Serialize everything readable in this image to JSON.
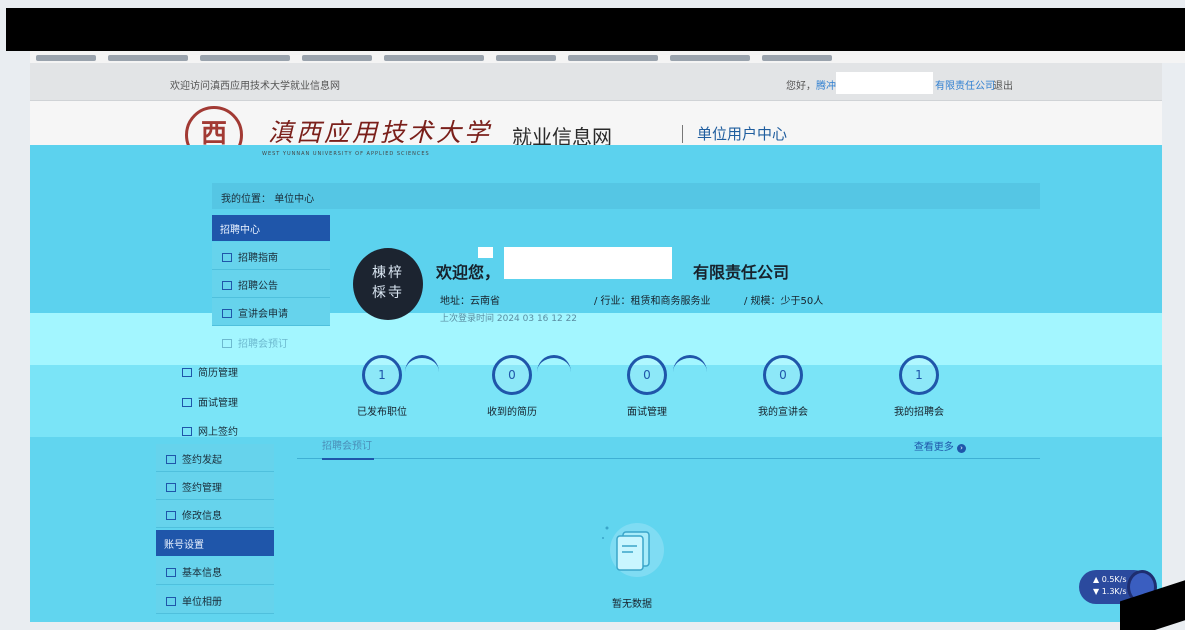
{
  "topbar": {
    "welcome": "欢迎访问滇西应用技术大学就业信息网",
    "greeting_prefix": "您好，",
    "greeting_user": "腾冲",
    "company_short": "有限责任公司",
    "logout": "退出"
  },
  "header": {
    "seal_glyph": "西",
    "university_name": "滇西应用技术大学",
    "university_en": "WEST YUNNAN UNIVERSITY OF APPLIED SCIENCES",
    "site_name": "就业信息网",
    "center_title": "单位用户中心"
  },
  "breadcrumb": {
    "label": "我的位置：",
    "current": "单位中心"
  },
  "sidebar": {
    "recruit_header": "招聘中心",
    "recruit_items": [
      "招聘指南",
      "招聘公告",
      "宣讲会申请",
      "招聘会预订",
      "简历管理",
      "面试管理",
      "网上签约"
    ],
    "sign_items": [
      "签约发起",
      "签约管理",
      "修改信息"
    ],
    "account_header": "账号设置",
    "account_items": [
      "基本信息",
      "单位相册"
    ]
  },
  "profile": {
    "avatar_text": "棟梓\n棌寺",
    "welcome": "欢迎您，",
    "company_suffix": "有限责任公司",
    "address": "地址：云南省",
    "industry": "/ 行业：租赁和商务服务业",
    "size": "/ 规模：少于50人",
    "last_login": "上次登录时间  2024 03 16 12 22"
  },
  "stats": [
    {
      "value": "1",
      "label": "已发布职位"
    },
    {
      "value": "0",
      "label": "收到的简历"
    },
    {
      "value": "0",
      "label": "面试管理"
    },
    {
      "value": "0",
      "label": "我的宣讲会"
    },
    {
      "value": "1",
      "label": "我的招聘会"
    }
  ],
  "tabs": {
    "active": "招聘会预订",
    "more": "查看更多"
  },
  "empty": {
    "text": "暂无数据"
  },
  "net": {
    "up": "0.5K/s",
    "down": "1.3K/s"
  },
  "colors": {
    "accent": "#1f56aa",
    "cyan_band": "#5cd2ee",
    "seal": "#a23a34"
  }
}
